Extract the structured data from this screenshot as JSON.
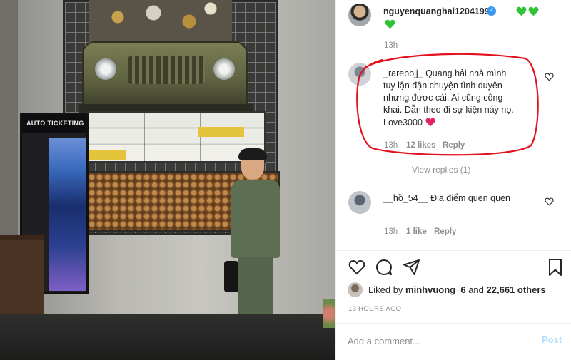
{
  "photo": {
    "kiosk_label": "AUTO TICKETING",
    "alt": ""
  },
  "post": {
    "author": "nguyenquanghai12041997",
    "author_time": "13h",
    "verified": true,
    "heart_color": "#2ecc40"
  },
  "comments": [
    {
      "user": "_rarebbjj_",
      "text": "Quang hải nhà mình tuy lận đận chuyện tình duyên nhưng được cái. Ai cũng công khai. Dẫn theo đi sự kiện này nọ. Love3000",
      "time": "13h",
      "likes": "12 likes",
      "reply": "Reply",
      "view_replies": "View replies (1)",
      "heart_color": "#e0245e"
    },
    {
      "user": "__hồ_54__",
      "text": "Địa điểm quen quen",
      "time": "13h",
      "likes": "1 like",
      "reply": "Reply"
    }
  ],
  "liked_by": {
    "prefix": "Liked by",
    "user": "minhvuong_6",
    "joiner": "and",
    "count": "22,661 others"
  },
  "timestamp": "13 HOURS AGO",
  "comment_box": {
    "placeholder": "Add a comment...",
    "post_label": "Post",
    "post_color": "#b2dffc"
  },
  "annotation_color": "#e3101d"
}
